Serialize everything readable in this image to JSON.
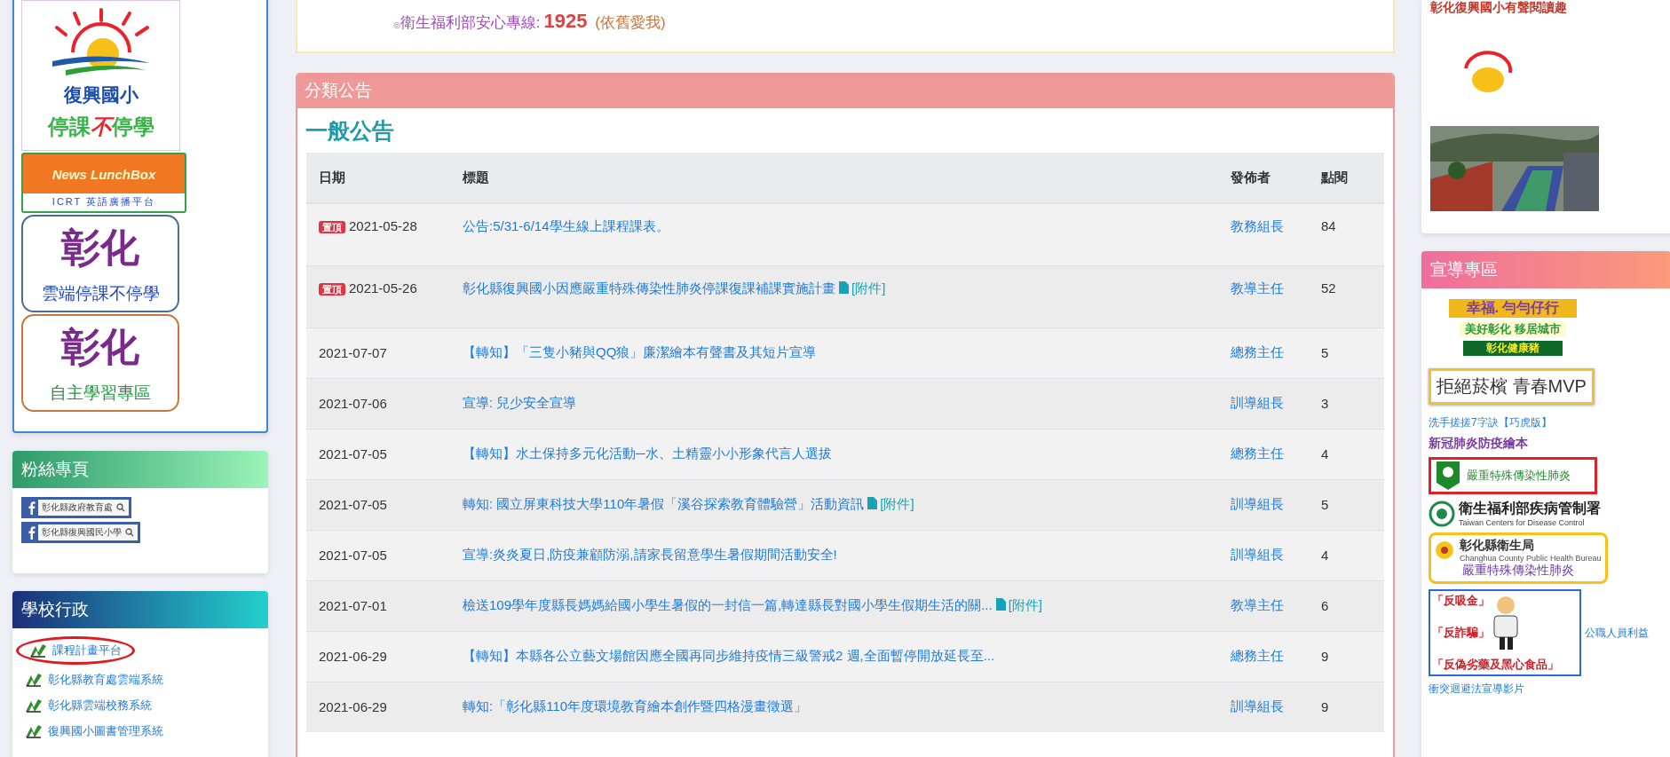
{
  "left": {
    "banners": [
      {
        "kind": "sun-logo",
        "title": "復興國小",
        "slogan": [
          "停課",
          "不",
          "停學"
        ]
      },
      {
        "kind": "lunchbox",
        "title": "News LunchBox",
        "subtitle": "ICRT 英語廣播平台"
      },
      {
        "kind": "changhua",
        "title": "彰化",
        "subtitle": "雲端停課不停學",
        "color": "#4a6e96"
      },
      {
        "kind": "changhua",
        "title": "彰化",
        "subtitle": "自主學習專區",
        "color": "#c8763a"
      }
    ],
    "fans": {
      "title": "粉絲專頁",
      "pages": [
        "彰化縣政府教育處",
        "彰化縣復興國民小學"
      ]
    },
    "admin": {
      "title": "學校行政",
      "items": [
        {
          "label": "課程計畫平台",
          "circled": true
        },
        {
          "label": "彰化縣教育處雲端系統",
          "circled": false
        },
        {
          "label": "彰化縣雲端校務系統",
          "circled": false
        },
        {
          "label": "復興國小圖書管理系統",
          "circled": false
        }
      ]
    }
  },
  "hotline": {
    "marker": "◎",
    "label": "衛生福利部安心專線:",
    "number": "1925",
    "note": "(依舊愛我)"
  },
  "announcements": {
    "title": "分類公告",
    "category": "一般公告",
    "columns": [
      "日期",
      "標題",
      "發佈者",
      "點閱"
    ],
    "rows": [
      {
        "badge": "置頂",
        "date": "2021-05-28",
        "title": "公告:5/31-6/14學生線上課程課表。",
        "publisher": "教務組長",
        "clicks": "84"
      },
      {
        "badge": "置頂",
        "date": "2021-05-26",
        "title": "彰化縣復興國小因應嚴重特殊傳染性肺炎停課復課補課實施計畫",
        "attachment": "[附件]",
        "publisher": "教導主任",
        "clicks": "52"
      },
      {
        "date": "2021-07-07",
        "title": "【轉知】「三隻小豬與QQ狼」廉潔繪本有聲書及其短片宣導",
        "publisher": "總務主任",
        "clicks": "5"
      },
      {
        "date": "2021-07-06",
        "title": "宣導: 兒少安全宣導",
        "publisher": "訓導組長",
        "clicks": "3"
      },
      {
        "date": "2021-07-05",
        "title": "【轉知】水土保持多元化活動─水、土精靈小小形象代言人選拔",
        "publisher": "總務主任",
        "clicks": "4"
      },
      {
        "date": "2021-07-05",
        "title": "轉知: 國立屏東科技大學110年暑假「溪谷探索教育體驗營」活動資訊",
        "attachment": "[附件]",
        "publisher": "訓導組長",
        "clicks": "5"
      },
      {
        "date": "2021-07-05",
        "title": "宣導:炎炎夏日,防疫兼顧防溺,請家長留意學生暑假期間活動安全!",
        "publisher": "訓導組長",
        "clicks": "4"
      },
      {
        "date": "2021-07-01",
        "title": "檢送109學年度縣長媽媽給國小學生暑假的一封信一篇,轉達縣長對國小學生假期生活的關...",
        "attachment": "[附件]",
        "publisher": "教導主任",
        "clicks": "6"
      },
      {
        "date": "2021-06-29",
        "title": "【轉知】本縣各公立藝文場館因應全國再同步維持疫情三級警戒2 週,全面暫停開放延長至...",
        "publisher": "總務主任",
        "clicks": "9"
      },
      {
        "date": "2021-06-29",
        "title": "轉知:「彰化縣110年度環境教育繪本創作暨四格漫畫徵選」",
        "publisher": "訓導組長",
        "clicks": "9"
      }
    ]
  },
  "right": {
    "video": {
      "title": "彰化復興國小有聲閱讀趣",
      "kind": "picture"
    },
    "promo": {
      "title": "宣導專區",
      "items": [
        {
          "kind": "slogans",
          "lines": [
            "幸福. 勻勻仔行",
            "美好彰化 移居城市",
            "彰化健康豬"
          ]
        },
        {
          "kind": "framed",
          "lines": [
            "拒絕菸檳 青春MVP"
          ]
        },
        {
          "kind": "link",
          "lines": [
            "洗手搓搓7字訣【巧虎版】"
          ]
        },
        {
          "kind": "heading",
          "lines": [
            "新冠肺炎防疫繪本"
          ]
        },
        {
          "kind": "virus",
          "lines": [
            "嚴重特殊傳染性肺炎"
          ]
        },
        {
          "kind": "cdc",
          "lines": [
            "衛生福利部疾病管制署",
            "Taiwan Centers for Disease Control"
          ]
        },
        {
          "kind": "health",
          "lines": [
            "彰化縣衛生局",
            "Changhua County Public Health Bureau",
            "嚴重特殊傳染性肺炎"
          ]
        },
        {
          "kind": "anti",
          "lines": [
            "「反吸金」",
            "「反詐騙」",
            "「反偽劣藥及黑心食品」"
          ],
          "link": "公職人員利益"
        },
        {
          "kind": "link",
          "lines": [
            "衝突迴避法宣導影片"
          ]
        }
      ]
    }
  }
}
